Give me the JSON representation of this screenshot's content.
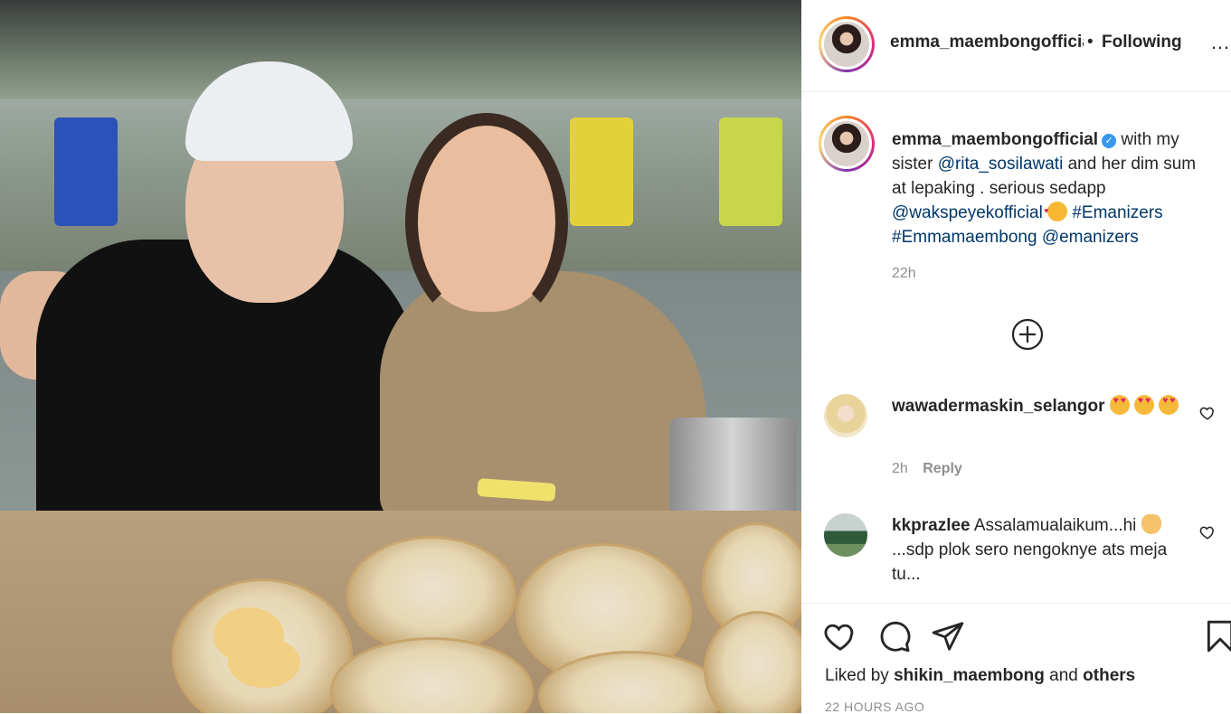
{
  "post": {
    "author": "emma_maembongofficial",
    "follow_status": "Following",
    "header_separator": "•",
    "more_icon": "more-horizontal-icon",
    "caption": {
      "username": "emma_maembongofficial",
      "text_1": "with my sister",
      "mention_1": "@rita_sosilawati",
      "text_2": "and her dim sum at lepaking . serious sedapp",
      "mention_2": "@wakspeyekofficial",
      "hashtag_1": "#Emanizers",
      "hashtag_2": "#Emmamaembong",
      "mention_3": "@emanizers",
      "time": "22h"
    },
    "comments": [
      {
        "username": "wawadermaskin_selangor",
        "text": "",
        "time": "2h",
        "reply_label": "Reply"
      },
      {
        "username": "kkprazlee",
        "text_1": "Assalamualaikum...hi",
        "text_2": "...sdp plok sero nengoknye ats meja tu..."
      }
    ],
    "liked_by": {
      "prefix": "Liked by",
      "user": "shikin_maembong",
      "and": "and",
      "others": "others"
    },
    "timestamp": "22 HOURS AGO"
  },
  "colors": {
    "link": "#00376b",
    "secondary_text": "#8e8e8e",
    "verified": "#3897f0",
    "primary_text": "#262626"
  }
}
